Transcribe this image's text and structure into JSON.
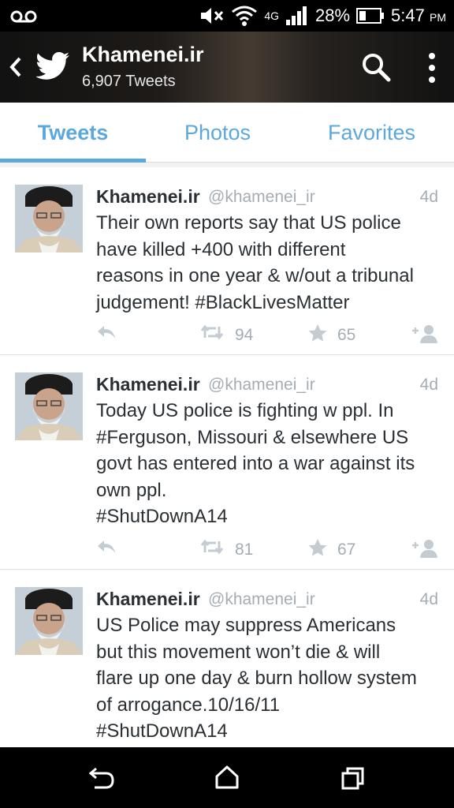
{
  "status_bar": {
    "network": "4G",
    "battery": "28%",
    "time": "5:47",
    "ampm": "PM"
  },
  "header": {
    "title": "Khamenei.ir",
    "subtitle": "6,907 Tweets"
  },
  "tabs": [
    {
      "label": "Tweets",
      "active": true
    },
    {
      "label": "Photos",
      "active": false
    },
    {
      "label": "Favorites",
      "active": false
    }
  ],
  "tweets": [
    {
      "name": "Khamenei.ir",
      "handle": "@khamenei_ir",
      "age": "4d",
      "text": "Their own reports say that US police\nhave killed +400 with different\nreasons in one year & w/out a tribunal\njudgement! #BlackLivesMatter",
      "retweets": "94",
      "favorites": "65"
    },
    {
      "name": "Khamenei.ir",
      "handle": "@khamenei_ir",
      "age": "4d",
      "text": "Today US police is fighting w ppl. In\n#Ferguson, Missouri & elsewhere US\ngovt has entered into a war against its\nown ppl.\n#ShutDownA14",
      "retweets": "81",
      "favorites": "67"
    },
    {
      "name": "Khamenei.ir",
      "handle": "@khamenei_ir",
      "age": "4d",
      "text": "US Police may suppress Americans\nbut this movement won’t die & will\nflare up one day & burn hollow system\nof arrogance.10/16/11\n#ShutDownA14",
      "retweets": "",
      "favorites": ""
    }
  ],
  "colors": {
    "accent": "#5ba8dc",
    "muted": "#a4adb4",
    "text": "#292f33",
    "action_icon": "#c3ccd3"
  }
}
